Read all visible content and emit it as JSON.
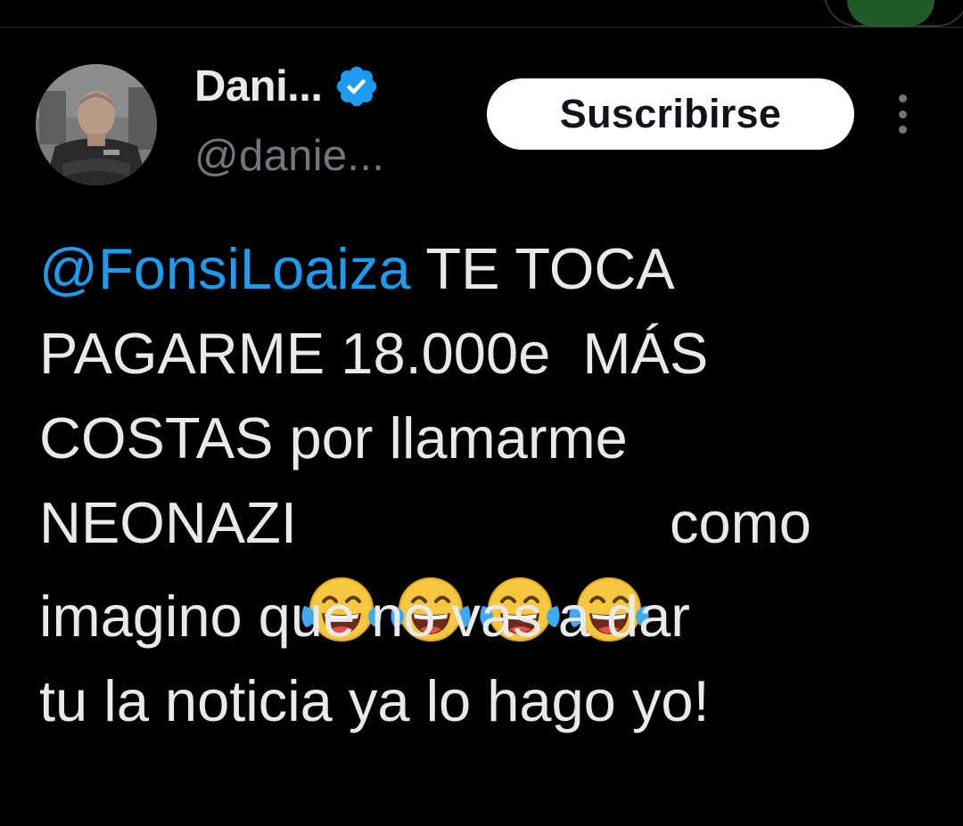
{
  "tweet": {
    "author": {
      "display_name": "Dani...",
      "handle": "@danie...",
      "verified": true,
      "avatar_icon": "profile-photo"
    },
    "subscribe_label": "Suscribirse",
    "more_icon": "more-vertical-icon",
    "text": {
      "mention": "@FonsiLoaiza",
      "line1_rest": " TE TOCA",
      "line2": "PAGARME 18.000e  MÁS",
      "line3": "COSTAS por llamarme",
      "line4_start": "NEONAZI",
      "emoji_name": "face-with-tears-of-joy-icon",
      "emoji_count": 4,
      "line4_end": " como",
      "line5": "imagino que no vas a dar",
      "line6": "tu la noticia ya lo hago yo!"
    }
  },
  "colors": {
    "background": "#000000",
    "text": "#e7e9ea",
    "secondary_text": "#71767b",
    "mention": "#1d9bf0",
    "verified_badge": "#1d9bf0",
    "subscribe_bg": "#ffffff",
    "subscribe_text": "#0f1419"
  }
}
